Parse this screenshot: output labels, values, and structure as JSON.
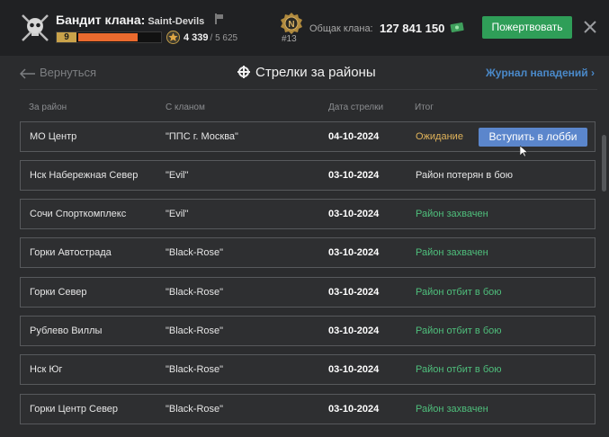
{
  "header": {
    "clan_label": "Бандит клана:",
    "clan_name": "Saint-Devils",
    "level": "9",
    "level_progress": 0.72,
    "rating": "4 339",
    "rating_max": "/ 5 625",
    "rank": "#13",
    "fund_label": "Общак клана:",
    "fund_value": "127 841 150",
    "donate_label": "Пожертвовать"
  },
  "nav": {
    "back_label": "Вернуться",
    "title": "Стрелки за районы",
    "journal_label": "Журнал нападений ›"
  },
  "table": {
    "headers": [
      "За район",
      "С кланом",
      "Дата стрелки",
      "Итог"
    ],
    "rows": [
      {
        "district": "МО Центр",
        "clan": "\"ППС г. Москва\"",
        "date": "04-10-2024",
        "result": "Ожидание",
        "status": "wait",
        "action": "Вступить в лобби"
      },
      {
        "district": "Нск Набережная Север",
        "clan": "\"Evil\"",
        "date": "03-10-2024",
        "result": "Район потерян в бою",
        "status": "lost"
      },
      {
        "district": "Сочи Спорткомплекс",
        "clan": "\"Evil\"",
        "date": "03-10-2024",
        "result": "Район захвачен",
        "status": "good"
      },
      {
        "district": "Горки Автострада",
        "clan": "\"Black-Rose\"",
        "date": "03-10-2024",
        "result": "Район захвачен",
        "status": "good"
      },
      {
        "district": "Горки Север",
        "clan": "\"Black-Rose\"",
        "date": "03-10-2024",
        "result": "Район отбит в бою",
        "status": "good"
      },
      {
        "district": "Рублево Виллы",
        "clan": "\"Black-Rose\"",
        "date": "03-10-2024",
        "result": "Район отбит в бою",
        "status": "good"
      },
      {
        "district": "Нск Юг",
        "clan": "\"Black-Rose\"",
        "date": "03-10-2024",
        "result": "Район отбит в бою",
        "status": "good"
      },
      {
        "district": "Горки Центр Север",
        "clan": "\"Black-Rose\"",
        "date": "03-10-2024",
        "result": "Район захвачен",
        "status": "good"
      }
    ]
  },
  "colors": {
    "accent_green": "#2f9e58",
    "link_blue": "#4a89c9",
    "status_wait": "#e0b35a",
    "status_good": "#4fbf7c",
    "progress_orange": "#ea6a2e"
  },
  "icons": {
    "emblem": "skull-emblem-icon",
    "star": "star-rating-icon",
    "rank": "rank-badge-icon",
    "cash": "cash-icon",
    "close": "close-icon",
    "back": "arrow-left-icon",
    "title": "crosshair-icon",
    "cursor": "mouse-cursor-icon"
  }
}
